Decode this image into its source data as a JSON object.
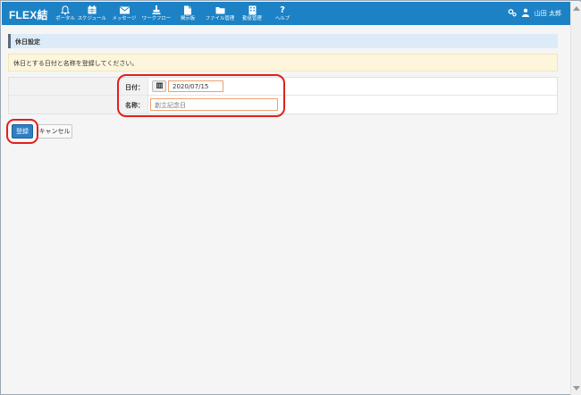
{
  "app": {
    "brand": "FLEX結"
  },
  "nav": {
    "items": [
      {
        "label": "ポータル",
        "icon": "bell-icon"
      },
      {
        "label": "スケジュール",
        "icon": "calendar-icon"
      },
      {
        "label": "メッセージ",
        "icon": "envelope-icon"
      },
      {
        "label": "ワークフロー",
        "icon": "stamp-icon"
      },
      {
        "label": "掲示板",
        "icon": "document-icon"
      },
      {
        "label": "ファイル管理",
        "icon": "folder-icon"
      },
      {
        "label": "勤怠管理",
        "icon": "building-icon"
      },
      {
        "label": "ヘルプ",
        "icon": "question-icon"
      }
    ]
  },
  "user": {
    "name": "山田 太郎"
  },
  "page": {
    "section_title": "休日設定",
    "notice": "休日とする日付と名称を登録してください。"
  },
  "form": {
    "date_label": "日付：",
    "date_value": "2020/07/15",
    "name_label": "名称：",
    "name_value": "創立記念日"
  },
  "buttons": {
    "register": "登録",
    "cancel": "キャンセル"
  },
  "colors": {
    "header": "#1c82c5",
    "primary_button": "#2f7fc2",
    "highlight": "#e0201c",
    "notice_bg": "#fdf6dd",
    "section_bg": "#dcebf7"
  }
}
